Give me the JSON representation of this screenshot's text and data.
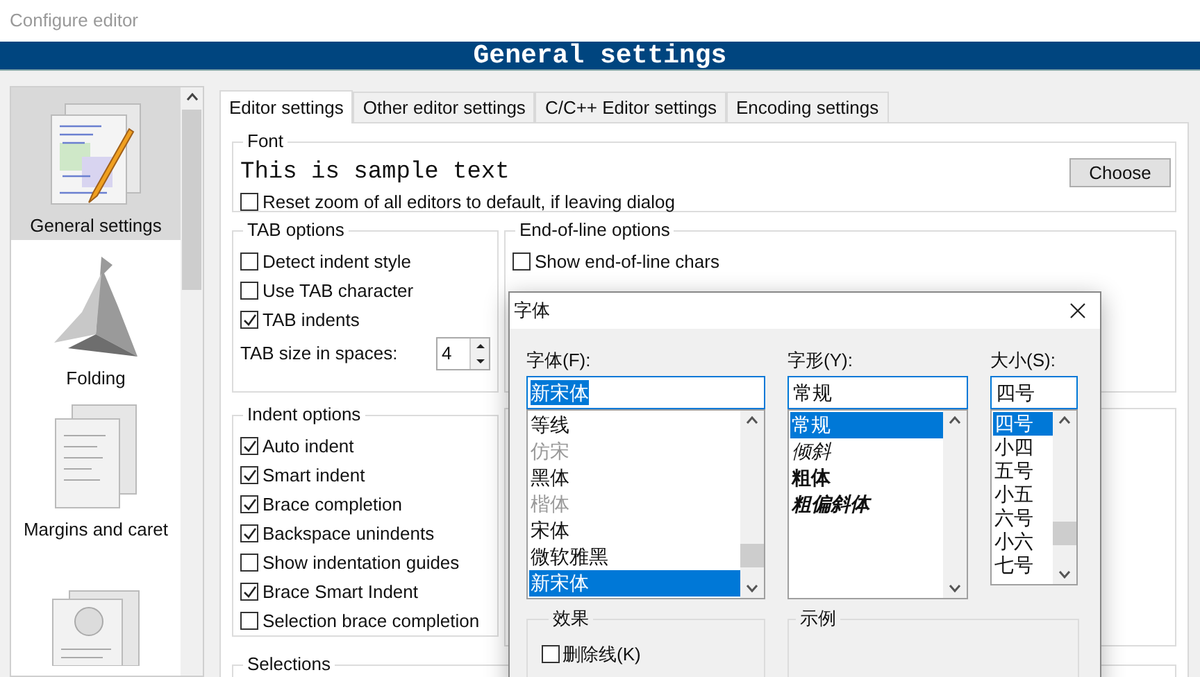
{
  "window": {
    "title": "Configure editor"
  },
  "header": {
    "title": "General settings"
  },
  "sidebar": {
    "items": [
      {
        "label": "General settings",
        "selected": true
      },
      {
        "label": "Folding",
        "selected": false
      },
      {
        "label": "Margins and caret",
        "selected": false
      },
      {
        "selected": false
      }
    ]
  },
  "tabs": [
    {
      "label": "Editor settings",
      "selected": true
    },
    {
      "label": "Other editor settings",
      "selected": false
    },
    {
      "label": "C/C++ Editor settings",
      "selected": false
    },
    {
      "label": "Encoding settings",
      "selected": false
    }
  ],
  "font_group": {
    "title": "Font",
    "sample": "This is sample text",
    "button": "Choose",
    "reset_option": {
      "label": "Reset zoom of all editors to default, if leaving dialog",
      "checked": false
    }
  },
  "tab_options": {
    "title": "TAB options",
    "options": [
      {
        "label": "Detect indent style",
        "checked": false
      },
      {
        "label": "Use TAB character",
        "checked": false
      },
      {
        "label": "TAB indents",
        "checked": true
      }
    ],
    "tab_size": {
      "label": "TAB size in spaces:",
      "value": "4"
    }
  },
  "eol_options": {
    "title": "End-of-line options",
    "options": [
      {
        "label": "Show end-of-line chars",
        "checked": false
      }
    ]
  },
  "indent_options": {
    "title": "Indent options",
    "options": [
      {
        "label": "Auto indent",
        "checked": true
      },
      {
        "label": "Smart indent",
        "checked": true
      },
      {
        "label": "Brace completion",
        "checked": true
      },
      {
        "label": "Backspace unindents",
        "checked": true
      },
      {
        "label": "Show indentation guides",
        "checked": false
      },
      {
        "label": "Brace Smart Indent",
        "checked": true
      },
      {
        "label": "Selection brace completion",
        "checked": false
      }
    ]
  },
  "selections": {
    "title": "Selections"
  },
  "font_dialog": {
    "title": "字体",
    "family": {
      "label": "字体(F):",
      "value": "新宋体",
      "items": [
        {
          "label": "等线",
          "dimmed": false,
          "selected": false
        },
        {
          "label": "仿宋",
          "dimmed": true,
          "selected": false
        },
        {
          "label": "黑体",
          "dimmed": false,
          "selected": false
        },
        {
          "label": "楷体",
          "dimmed": true,
          "selected": false
        },
        {
          "label": "宋体",
          "dimmed": false,
          "selected": false
        },
        {
          "label": "微软雅黑",
          "dimmed": false,
          "selected": false
        },
        {
          "label": "新宋体",
          "dimmed": false,
          "selected": true
        }
      ]
    },
    "style": {
      "label": "字形(Y):",
      "value": "常规",
      "items": [
        {
          "label": "常规",
          "kind": "regular",
          "selected": true
        },
        {
          "label": "倾斜",
          "kind": "italic",
          "selected": false
        },
        {
          "label": "粗体",
          "kind": "bold",
          "selected": false
        },
        {
          "label": "粗偏斜体",
          "kind": "bold-italic",
          "selected": false
        }
      ]
    },
    "size": {
      "label": "大小(S):",
      "value": "四号",
      "items": [
        {
          "label": "四号",
          "selected": true
        },
        {
          "label": "小四",
          "selected": false
        },
        {
          "label": "五号",
          "selected": false
        },
        {
          "label": "小五",
          "selected": false
        },
        {
          "label": "六号",
          "selected": false
        },
        {
          "label": "小六",
          "selected": false
        },
        {
          "label": "七号",
          "selected": false
        }
      ]
    },
    "effects": {
      "title": "效果",
      "strikeout": {
        "label": "删除线(K)",
        "checked": false
      }
    },
    "sample": {
      "title": "示例"
    }
  }
}
